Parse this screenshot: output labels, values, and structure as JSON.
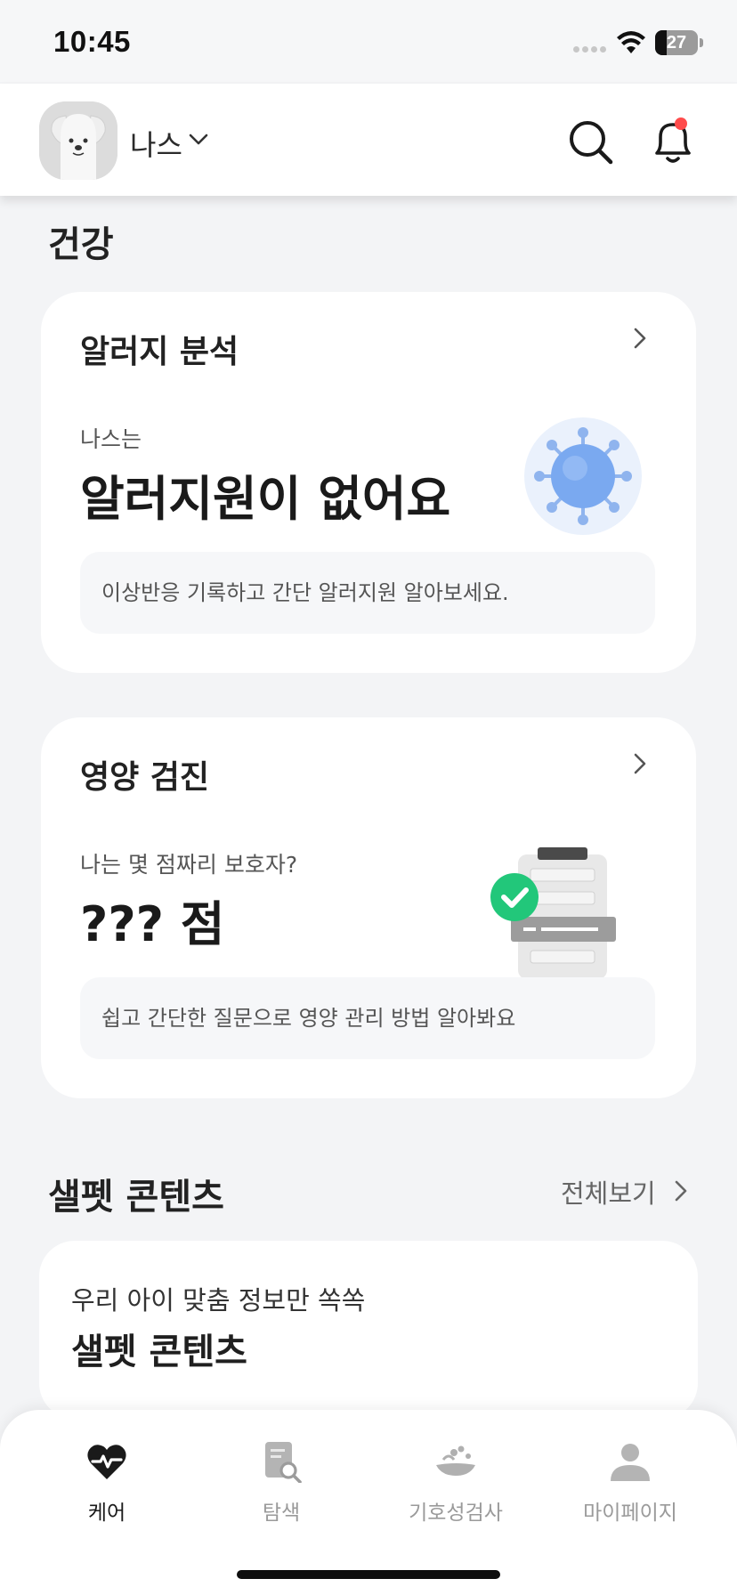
{
  "status_bar": {
    "time": "10:45",
    "battery_percent": 27,
    "battery_text": "27"
  },
  "header": {
    "pet_name": "나스",
    "icons": [
      "dog-avatar",
      "chevron-down-icon",
      "search-icon",
      "bell-icon"
    ],
    "has_notification": true
  },
  "health": {
    "section_title": "건강",
    "allergy_card": {
      "title": "알러지 분석",
      "subtitle": "나스는",
      "headline": "알러지원이 없어요",
      "note": "이상반응 기록하고 간단 알러지원 알아보세요."
    },
    "nutrition_card": {
      "title": "영양 검진",
      "subtitle": "나는 몇 점짜리 보호자?",
      "headline": "??? 점",
      "note": "쉽고 간단한 질문으로 영양 관리 방법 알아봐요"
    }
  },
  "content_section": {
    "title": "샐펫 콘텐츠",
    "view_all": "전체보기",
    "card": {
      "subtitle": "우리 아이 맞춤 정보만 쏙쏙",
      "title": "샐펫 콘텐츠"
    }
  },
  "bottom_nav": {
    "items": [
      {
        "label": "케어",
        "icon": "heart-pulse-icon",
        "active": true
      },
      {
        "label": "탐색",
        "icon": "document-search-icon",
        "active": false
      },
      {
        "label": "기호성검사",
        "icon": "pet-bowl-icon",
        "active": false
      },
      {
        "label": "마이페이지",
        "icon": "person-icon",
        "active": false
      }
    ]
  },
  "colors": {
    "background": "#f3f4f6",
    "card": "#ffffff",
    "note_background": "#f6f7f9",
    "notification_dot": "#ff4b4b",
    "check_green": "#22c77a",
    "virus_blue": "#7aa9f0"
  }
}
